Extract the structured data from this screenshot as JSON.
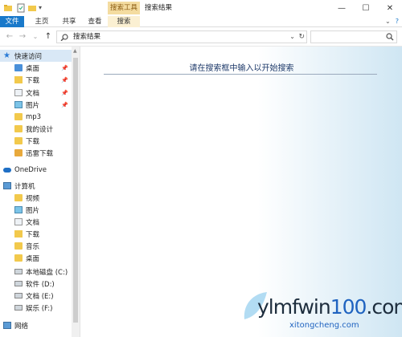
{
  "window": {
    "context_group": "搜索工具",
    "title": "搜索结果",
    "controls": {
      "minimize": "—",
      "maximize": "☐",
      "close": "✕"
    }
  },
  "ribbon": {
    "tabs": [
      "文件",
      "主页",
      "共享",
      "查看",
      "搜索"
    ],
    "collapse": "⌄",
    "help": "?"
  },
  "address": {
    "back": "←",
    "forward": "→",
    "recent": "⌄",
    "up": "↑",
    "crumb": "搜索结果",
    "dropdown": "⌄",
    "refresh": "↻",
    "search_value": ""
  },
  "sidebar": {
    "quick_access": "快速访问",
    "quick_items": [
      "桌面",
      "下载",
      "文档",
      "图片",
      "mp3",
      "我的设计",
      "下载",
      "迅雷下载"
    ],
    "onedrive": "OneDrive",
    "computer": "计算机",
    "computer_items": [
      "视频",
      "图片",
      "文档",
      "下载",
      "音乐",
      "桌面",
      "本地磁盘 (C:)",
      "软件 (D:)",
      "文档 (E:)",
      "娱乐 (F:)"
    ],
    "network": "网络"
  },
  "content": {
    "hint": "请在搜索框中输入以开始搜索"
  },
  "watermark": {
    "main_a": "ylmfwin",
    "main_b": "100",
    "main_c": ".com",
    "sub": "xitongcheng.com"
  },
  "colors": {
    "file_tab": "#1979ca",
    "context_tab": "#f4dca0",
    "hint_text": "#1e3a6a"
  }
}
